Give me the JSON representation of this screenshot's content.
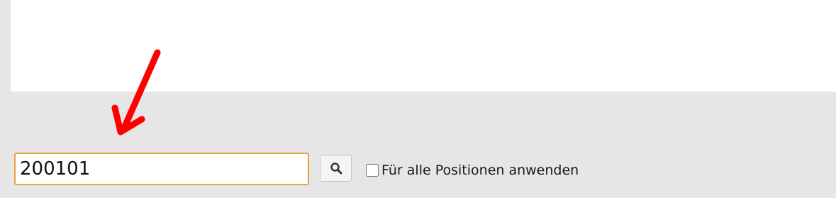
{
  "search": {
    "value": "200101",
    "button_icon": "search-icon"
  },
  "options": {
    "apply_all_label": "Für alle Positionen anwenden",
    "apply_all_checked": false
  },
  "annotation": {
    "type": "arrow",
    "color": "#ff0000",
    "points_to": "search-input"
  },
  "colors": {
    "input_focus_border": "#e8a23a",
    "background": "#e6e6e6",
    "panel": "#ffffff"
  }
}
